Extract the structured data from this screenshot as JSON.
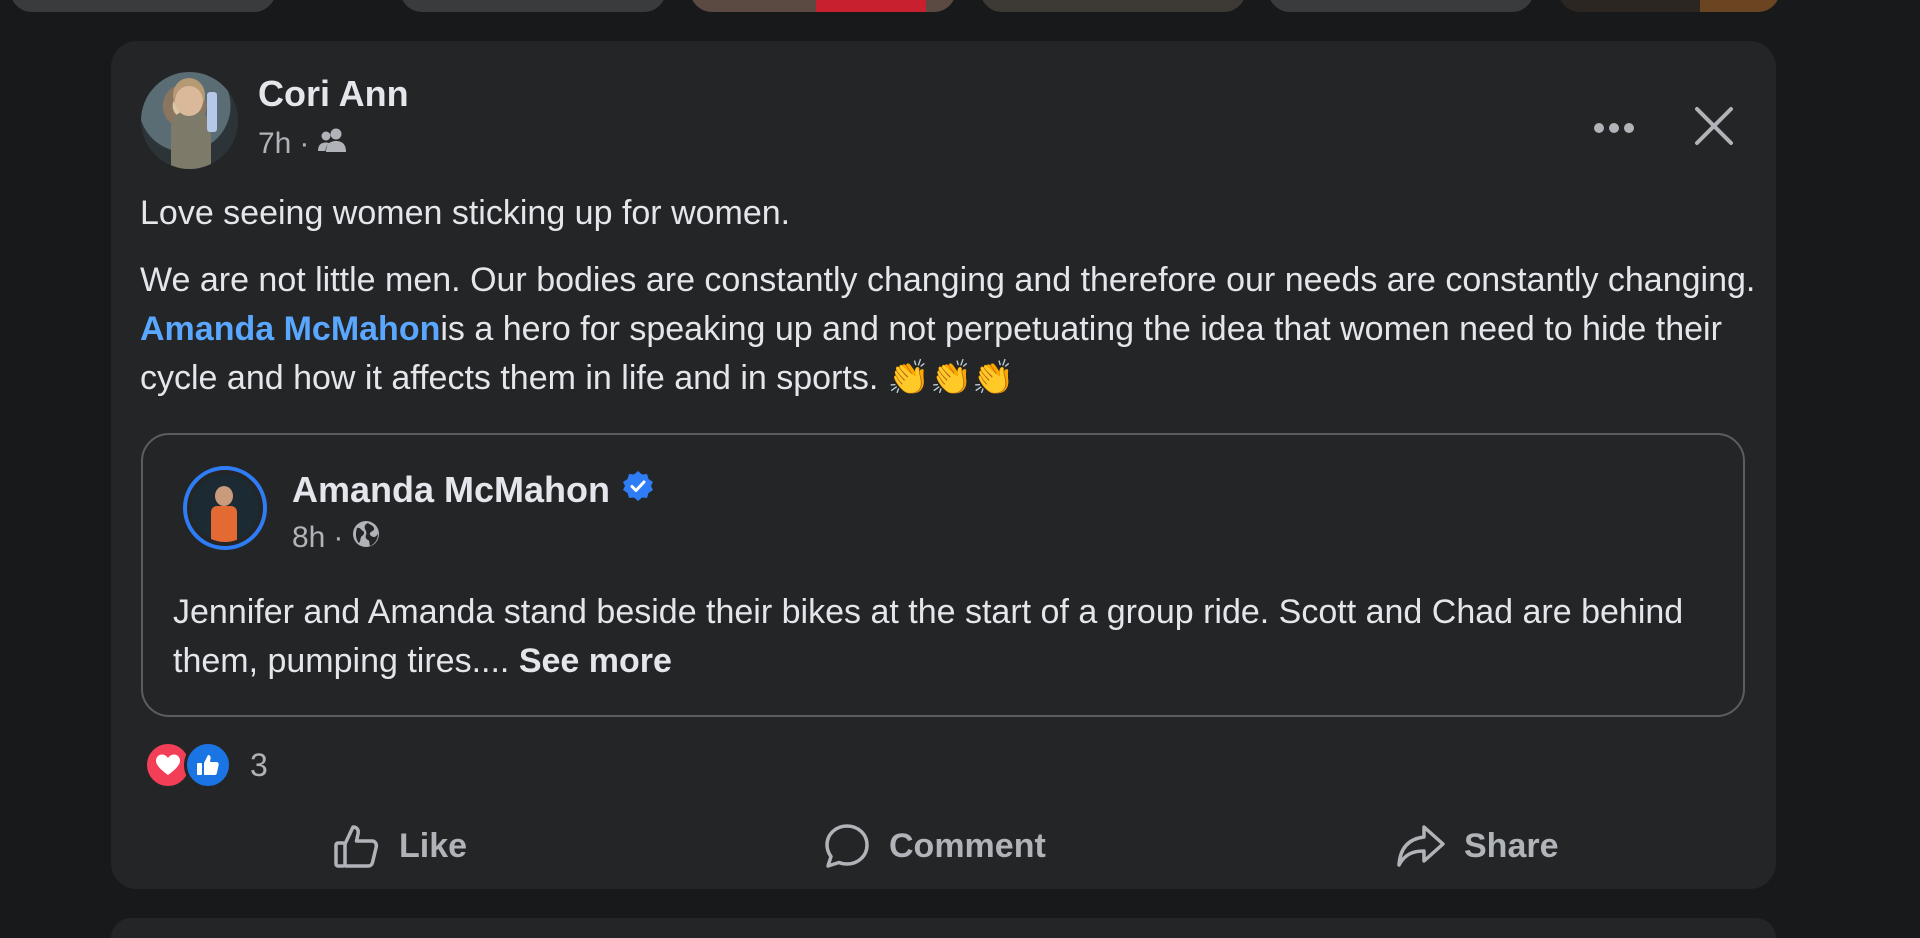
{
  "post": {
    "author": "Cori Ann",
    "time": "7h",
    "separator": "·",
    "audience_icon": "friends-icon",
    "paragraph1": "Love seeing women sticking up for women.",
    "paragraph2_before": "We are not little men. Our bodies are constantly changing and therefore our needs are constantly changing. ",
    "mention": "Amanda McMahon",
    "paragraph2_after": "is a hero for speaking up and not perpetuating the idea that women need to hide their cycle and how it affects them in life and in sports. ",
    "emojis": "👏👏👏"
  },
  "shared": {
    "author": "Amanda McMahon",
    "verified_icon": "verified-badge-icon",
    "time": "8h",
    "separator": "·",
    "audience_icon": "globe-icon",
    "text": "Jennifer and Amanda stand beside their bikes at the start of a group ride. Scott and Chad are behind them, pumping tires.... ",
    "see_more": "See more"
  },
  "reactions": {
    "types": [
      "love",
      "like"
    ],
    "count": "3"
  },
  "actions": {
    "like": "Like",
    "comment": "Comment",
    "share": "Share"
  },
  "colors": {
    "background": "#18191a",
    "card": "#242526",
    "text": "#e4e6eb",
    "secondary_text": "#b0b3b8",
    "link": "#5aa7ff",
    "love": "#f33e58",
    "like": "#1b74e4",
    "verified": "#2e7cf6"
  }
}
